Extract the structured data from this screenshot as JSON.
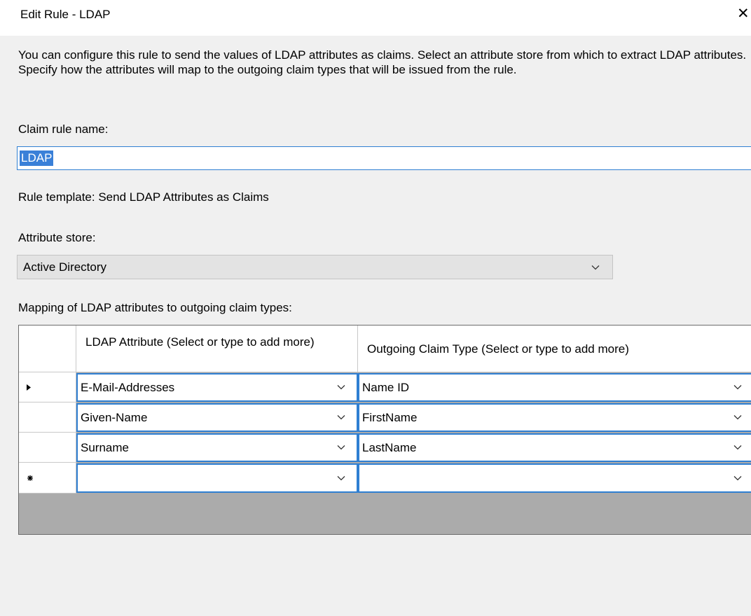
{
  "window": {
    "title": "Edit Rule - LDAP",
    "close_glyph": "✕"
  },
  "description": "You can configure this rule to send the values of LDAP attributes as claims. Select an attribute store from which to extract LDAP attributes. Specify how the attributes will map to the outgoing claim types that will be issued from the rule.",
  "claim_rule_name": {
    "label": "Claim rule name:",
    "value": "LDAP"
  },
  "rule_template": "Rule template: Send LDAP Attributes as Claims",
  "attribute_store": {
    "label": "Attribute store:",
    "selected": "Active Directory"
  },
  "mapping": {
    "label": "Mapping of LDAP attributes to outgoing claim types:",
    "columns": [
      "LDAP Attribute (Select or type to add more)",
      "Outgoing Claim Type (Select or type to add more)"
    ],
    "rows": [
      {
        "marker": "current-row-arrow",
        "ldap_attribute": "E-Mail-Addresses",
        "claim_type": "Name ID"
      },
      {
        "marker": "",
        "ldap_attribute": "Given-Name",
        "claim_type": "FirstName"
      },
      {
        "marker": "",
        "ldap_attribute": "Surname",
        "claim_type": "LastName"
      },
      {
        "marker": "new-row-asterisk",
        "ldap_attribute": "",
        "claim_type": ""
      }
    ]
  },
  "colors": {
    "accent": "#2f7fd2",
    "selection": "#3a80d8",
    "grid_empty": "#ababab",
    "dialog_bg": "#f0f0f0"
  }
}
